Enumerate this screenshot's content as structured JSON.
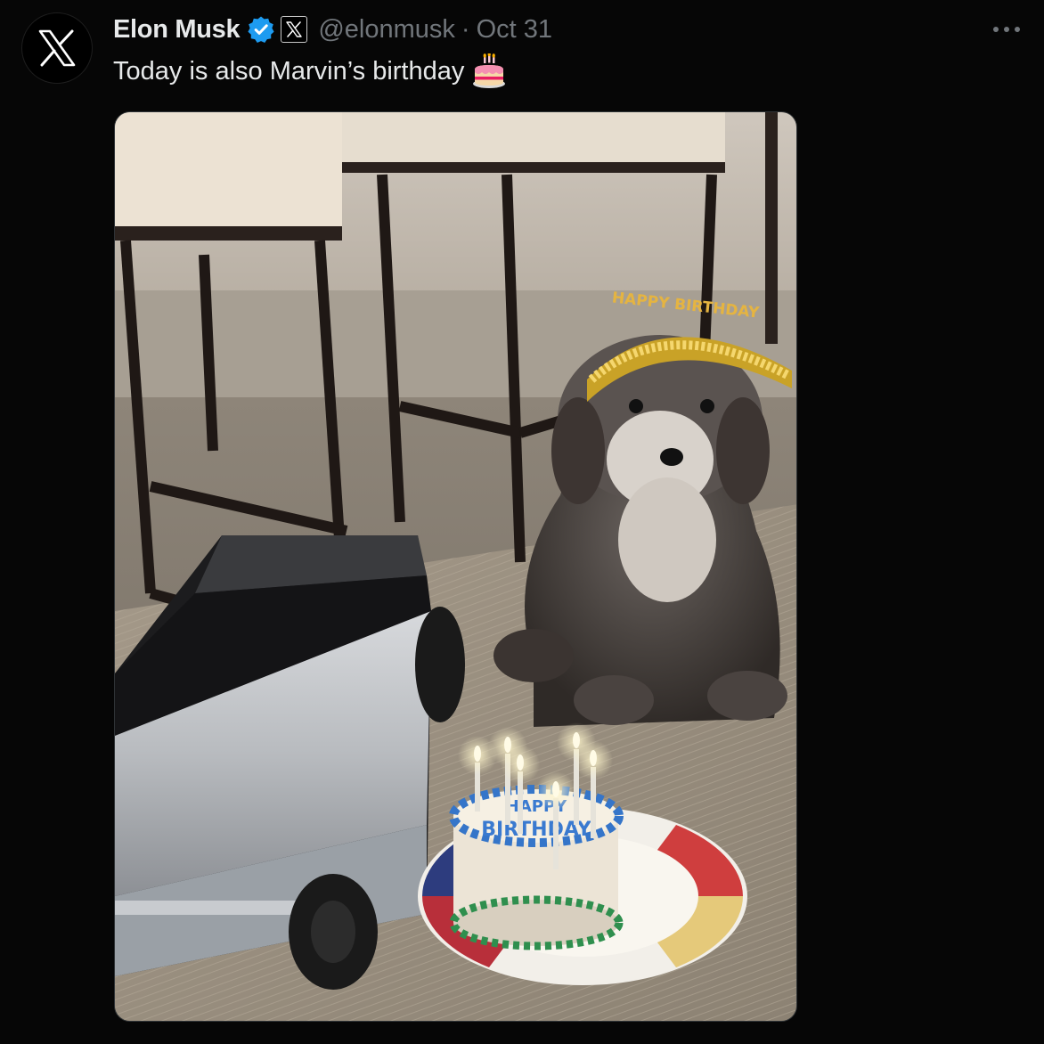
{
  "tweet": {
    "display_name": "Elon Musk",
    "handle": "@elonmusk",
    "separator": "·",
    "date": "Oct 31",
    "text": "Today is also Marvin’s birthday",
    "emoji": "birthday-cake-emoji"
  },
  "media": {
    "type": "photo",
    "hat_text": "HAPPY BIRTHDAY",
    "cake_text_line1": "HAPPY",
    "cake_text_line2": "BIRTHDAY"
  },
  "colors": {
    "background": "#000000",
    "text_primary": "#e7e9ea",
    "text_secondary": "#71767b",
    "verified_blue": "#1d9bf0"
  },
  "icons": {
    "avatar": "x-logo-icon",
    "verified": "verified-badge-icon",
    "affiliate": "x-affiliate-badge-icon",
    "more": "more-options-icon"
  }
}
